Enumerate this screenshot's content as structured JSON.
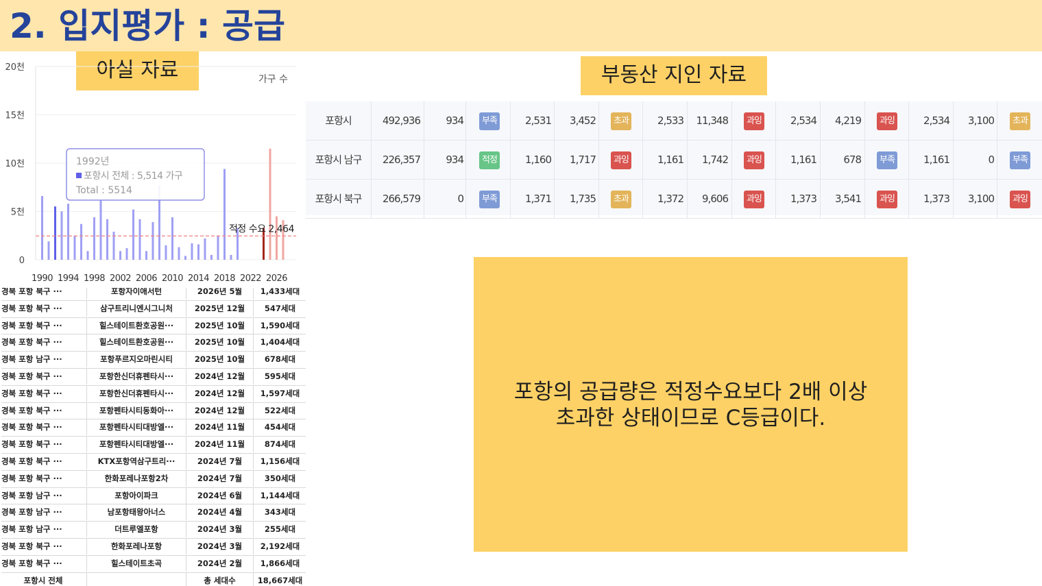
{
  "page": {
    "title": "2. 입지평가 : 공급"
  },
  "labels": {
    "left": "아실 자료",
    "right": "부동산 지인 자료"
  },
  "chart_data": {
    "type": "bar",
    "unit_label": "가구 수",
    "x_ticks": [
      "1990",
      "1994",
      "1998",
      "2002",
      "2006",
      "2010",
      "2014",
      "2018",
      "2022",
      "2026"
    ],
    "y_ticks": [
      "0",
      "5천",
      "10천",
      "15천",
      "20천"
    ],
    "ylim": [
      0,
      20000
    ],
    "xlim": [
      1989,
      2029
    ],
    "series": [
      {
        "values": [
          {
            "x": 1990,
            "y": 6600
          },
          {
            "x": 1991,
            "y": 1900
          },
          {
            "x": 1992,
            "y": 5514
          },
          {
            "x": 1993,
            "y": 5000
          },
          {
            "x": 1994,
            "y": 5800
          },
          {
            "x": 1995,
            "y": 2500
          },
          {
            "x": 1996,
            "y": 3700
          },
          {
            "x": 1997,
            "y": 900
          },
          {
            "x": 1998,
            "y": 4400
          },
          {
            "x": 1999,
            "y": 6200
          },
          {
            "x": 2000,
            "y": 4200
          },
          {
            "x": 2001,
            "y": 2900
          },
          {
            "x": 2002,
            "y": 900
          },
          {
            "x": 2003,
            "y": 1200
          },
          {
            "x": 2004,
            "y": 5200
          },
          {
            "x": 2005,
            "y": 4200
          },
          {
            "x": 2006,
            "y": 900
          },
          {
            "x": 2007,
            "y": 3900
          },
          {
            "x": 2008,
            "y": 7700
          },
          {
            "x": 2009,
            "y": 1500
          },
          {
            "x": 2010,
            "y": 4400
          },
          {
            "x": 2011,
            "y": 1300
          },
          {
            "x": 2012,
            "y": 400
          },
          {
            "x": 2013,
            "y": 1700
          },
          {
            "x": 2014,
            "y": 1600
          },
          {
            "x": 2015,
            "y": 2200
          },
          {
            "x": 2016,
            "y": 500
          },
          {
            "x": 2017,
            "y": 2500
          },
          {
            "x": 2018,
            "y": 9400
          },
          {
            "x": 2019,
            "y": 500
          },
          {
            "x": 2020,
            "y": 3300
          },
          {
            "x": 2024,
            "y": 3300
          },
          {
            "x": 2025,
            "y": 11500
          },
          {
            "x": 2026,
            "y": 4500
          },
          {
            "x": 2027,
            "y": 4100
          }
        ]
      }
    ],
    "reference_line": {
      "label": "적정 수요 2,464",
      "value": 2464
    },
    "tooltip": {
      "year": "1992년",
      "line1": "포항시 전체 : 5,514 가구",
      "line2": "Total : 5514"
    }
  },
  "left_table": {
    "rows": [
      [
        "경북 포항 북구 ···",
        "포항자이애서턴",
        "2026년 5월",
        "1,433세대"
      ],
      [
        "경북 포항 북구 ···",
        "삼구트리니엔시그니처",
        "2025년 12월",
        "547세대"
      ],
      [
        "경북 포항 북구 ···",
        "힐스테이트환호공원···",
        "2025년 10월",
        "1,590세대"
      ],
      [
        "경북 포항 북구 ···",
        "힐스테이트환호공원···",
        "2025년 10월",
        "1,404세대"
      ],
      [
        "경북 포항 남구 ···",
        "포항푸르지오마린시티",
        "2025년 10월",
        "678세대"
      ],
      [
        "경북 포항 북구 ···",
        "포항한신더휴펜타시···",
        "2024년 12월",
        "595세대"
      ],
      [
        "경북 포항 북구 ···",
        "포항한신더휴펜타시···",
        "2024년 12월",
        "1,597세대"
      ],
      [
        "경북 포항 북구 ···",
        "포항펜타시티동화아···",
        "2024년 12월",
        "522세대"
      ],
      [
        "경북 포항 북구 ···",
        "포항펜타시티대방엘···",
        "2024년 11월",
        "454세대"
      ],
      [
        "경북 포항 북구 ···",
        "포항펜타시티대방엘···",
        "2024년 11월",
        "874세대"
      ],
      [
        "경북 포항 북구 ···",
        "KTX포항역삼구트리···",
        "2024년 7월",
        "1,156세대"
      ],
      [
        "경북 포항 북구 ···",
        "한화포레나포항2차",
        "2024년 7월",
        "350세대"
      ],
      [
        "경북 포항 남구 ···",
        "포항아이파크",
        "2024년 6월",
        "1,144세대"
      ],
      [
        "경북 포항 남구 ···",
        "남포항태왕아너스",
        "2024년 4월",
        "343세대"
      ],
      [
        "경북 포항 남구 ···",
        "더트루엘포항",
        "2024년 3월",
        "255세대"
      ],
      [
        "경북 포항 북구 ···",
        "한화포레나포항",
        "2024년 3월",
        "2,192세대"
      ],
      [
        "경북 포항 북구 ···",
        "힐스테이트초곡",
        "2024년 2월",
        "1,866세대"
      ]
    ],
    "total": [
      "포항시 전체",
      "",
      "총 세대수",
      "18,667세대"
    ]
  },
  "right_table": {
    "badge_colors": {
      "부족": "#7f9bd6",
      "적정": "#67c587",
      "초과": "#e3b45a",
      "과잉": "#d9534f"
    },
    "rows": [
      {
        "name": "포항시",
        "pop": "492,936",
        "groups": [
          {
            "a": "934",
            "b": "",
            "badge": "부족"
          },
          {
            "a": "2,531",
            "b": "3,452",
            "badge": "초과"
          },
          {
            "a": "2,533",
            "b": "11,348",
            "badge": "과잉"
          },
          {
            "a": "2,534",
            "b": "4,219",
            "badge": "과잉"
          },
          {
            "a": "2,534",
            "b": "3,100",
            "badge": "초과"
          }
        ]
      },
      {
        "name": "포항시 남구",
        "pop": "226,357",
        "groups": [
          {
            "a": "934",
            "b": "",
            "badge": "적정"
          },
          {
            "a": "1,160",
            "b": "1,717",
            "badge": "과잉"
          },
          {
            "a": "1,161",
            "b": "1,742",
            "badge": "과잉"
          },
          {
            "a": "1,161",
            "b": "678",
            "badge": "부족"
          },
          {
            "a": "1,161",
            "b": "0",
            "badge": "부족"
          }
        ]
      },
      {
        "name": "포항시 북구",
        "pop": "266,579",
        "groups": [
          {
            "a": "0",
            "b": "",
            "badge": "부족"
          },
          {
            "a": "1,371",
            "b": "1,735",
            "badge": "초과"
          },
          {
            "a": "1,372",
            "b": "9,606",
            "badge": "과잉"
          },
          {
            "a": "1,373",
            "b": "3,541",
            "badge": "과잉"
          },
          {
            "a": "1,373",
            "b": "3,100",
            "badge": "과잉"
          }
        ]
      }
    ]
  },
  "callout": {
    "line1": "포항의 공급량은 적정수요보다 2배 이상",
    "line2": "초과한 상태이므로 C등급이다."
  }
}
